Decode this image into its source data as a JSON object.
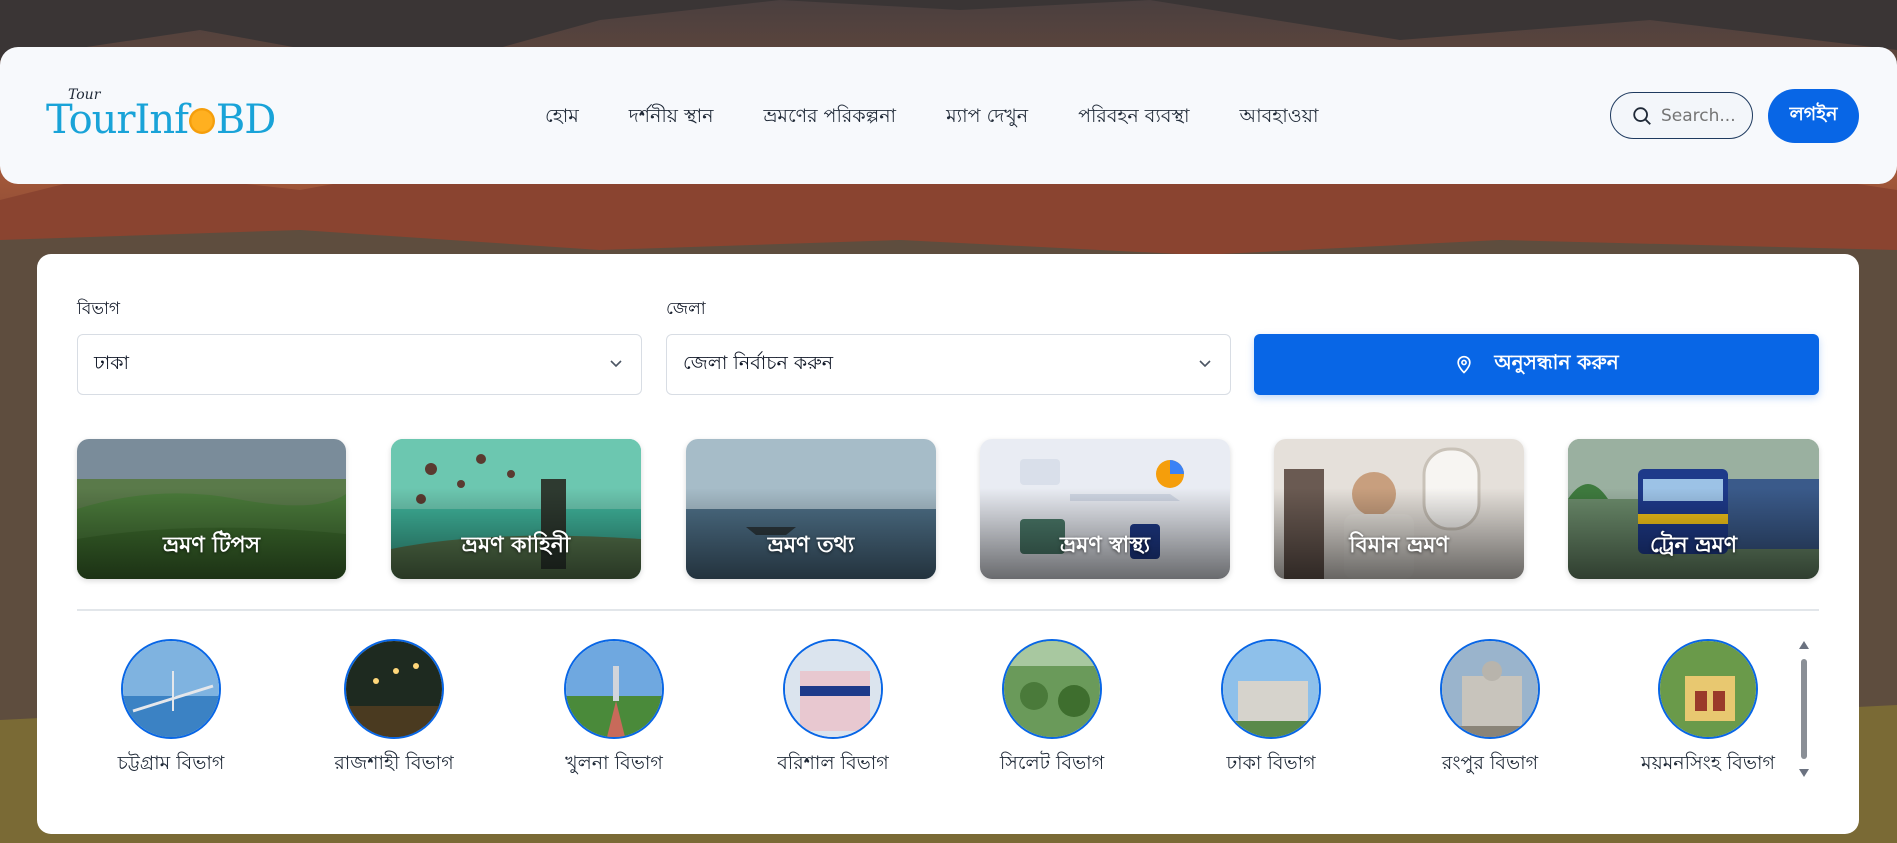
{
  "header": {
    "logo_small": "Tour",
    "logo_part1": "TourInf",
    "logo_part2": "BD",
    "nav": [
      "হোম",
      "দর্শনীয় স্থান",
      "ভ্রমণের পরিকল্পনা",
      "ম্যাপ দেখুন",
      "পরিবহন ব্যবস্থা",
      "আবহাওয়া"
    ],
    "search_placeholder": "Search...",
    "login_label": "লগইন"
  },
  "filters": {
    "division_label": "বিভাগ",
    "division_value": "ঢাকা",
    "district_label": "জেলা",
    "district_value": "জেলা নির্বাচন করুন",
    "search_button": "অনুসন্ধান করুন"
  },
  "categories": [
    {
      "label": "ভ্রমণ টিপস"
    },
    {
      "label": "ভ্রমণ কাহিনী"
    },
    {
      "label": "ভ্রমণ তথ্য"
    },
    {
      "label": "ভ্রমণ স্বাস্থ্য"
    },
    {
      "label": "বিমান ভ্রমণ"
    },
    {
      "label": "ট্রেন ভ্রমণ"
    }
  ],
  "divisions": [
    {
      "name": "চট্টগ্রাম বিভাগ"
    },
    {
      "name": "রাজশাহী বিভাগ"
    },
    {
      "name": "খুলনা বিভাগ"
    },
    {
      "name": "বরিশাল বিভাগ"
    },
    {
      "name": "সিলেট বিভাগ"
    },
    {
      "name": "ঢাকা বিভাগ"
    },
    {
      "name": "রংপুর বিভাগ"
    },
    {
      "name": "ময়মনসিংহ বিভাগ"
    }
  ],
  "colors": {
    "accent": "#0866e6",
    "logo": "#19a3d8",
    "sun": "#ffb020"
  }
}
